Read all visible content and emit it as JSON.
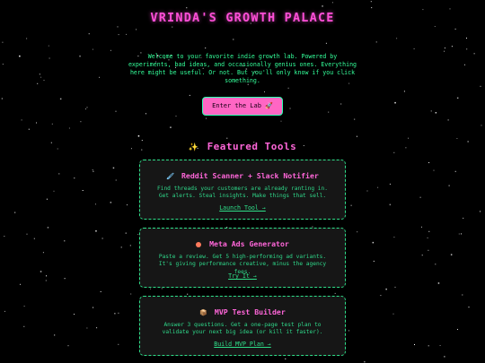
{
  "header": {
    "title": "VRINDA'S GROWTH PALACE"
  },
  "intro": {
    "text": "Welcome to your favorite indie growth lab. Powered by experiments, bad ideas, and occasionally genius ones. Everything here might be useful. Or not. But you'll only know if you click something."
  },
  "cta": {
    "label": "Enter the Lab 🚀"
  },
  "featured": {
    "heading_icon": "✨",
    "heading": "Featured Tools"
  },
  "tools": [
    {
      "icon": "brush-icon",
      "icon_glyph": "🖌",
      "title": "Reddit Scanner + Slack Notifier",
      "description": "Find threads your customers are already ranting in. Get alerts. Steal insights. Make things that sell.",
      "link": "Launch Tool →"
    },
    {
      "icon": "red-dot-icon",
      "icon_glyph": "",
      "title": "Meta Ads Generator",
      "description": "Paste a review. Get 5 high-performing ad variants. It's giving performance creative, minus the agency fees.",
      "link": "Try It →"
    },
    {
      "icon": "box-icon",
      "icon_glyph": "📦",
      "title": "MVP Test Builder",
      "description": "Answer 3 questions. Get a one-page test plan to validate your next big idea (or kill it faster).",
      "link": "Build MVP Plan →"
    }
  ],
  "colors": {
    "background": "#000000",
    "title": "#ff4fd8",
    "accent_green": "#2fe08a",
    "button_pink": "#ff66c4",
    "card_bg": "#161616"
  }
}
